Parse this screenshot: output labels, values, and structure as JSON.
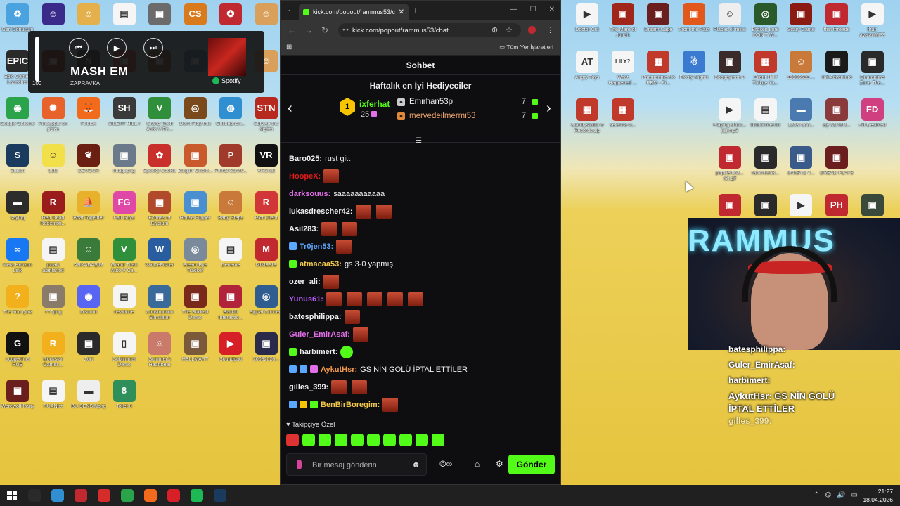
{
  "desktop": {
    "icons": [
      {
        "label": "Geri Dönüşüm",
        "color": "#4aa3df",
        "glyph": "♻"
      },
      {
        "label": "",
        "color": "#3a2a8a",
        "glyph": "☺"
      },
      {
        "label": "",
        "color": "#e3b04b",
        "glyph": "☺"
      },
      {
        "label": "",
        "color": "#f5f5f5",
        "glyph": "▤"
      },
      {
        "label": "",
        "color": "#6b6b6b",
        "glyph": "▣"
      },
      {
        "label": "",
        "color": "#d97b1c",
        "glyph": "CS"
      },
      {
        "label": "",
        "color": "#c0292f",
        "glyph": "✪"
      },
      {
        "label": "",
        "color": "#d9a05b",
        "glyph": "☺"
      },
      {
        "label": "Epic Games Launcher",
        "color": "#2a2a2a",
        "glyph": "EPIC"
      },
      {
        "label": "",
        "color": "#7d1e10",
        "glyph": "▣"
      },
      {
        "label": "",
        "color": "#2a2a2a",
        "glyph": "N"
      },
      {
        "label": "",
        "color": "#b03a2e",
        "glyph": "▣"
      },
      {
        "label": "",
        "color": "#7a4a2a",
        "glyph": "▣"
      },
      {
        "label": "",
        "color": "#3b82c4",
        "glyph": "▣"
      },
      {
        "label": "",
        "color": "#e23c2c",
        "glyph": "▣"
      },
      {
        "label": "",
        "color": "#d9a05b",
        "glyph": "☺"
      },
      {
        "label": "Google Chrome",
        "color": "#2aa34a",
        "glyph": "◉"
      },
      {
        "label": "Pineapple on pizza",
        "color": "#e8632b",
        "glyph": "✺"
      },
      {
        "label": "Firefox",
        "color": "#f26a1b",
        "glyph": "🦊"
      },
      {
        "label": "SILENT HILL f",
        "color": "#3a3a3a",
        "glyph": "SH"
      },
      {
        "label": "Grand Theft Auto V En...",
        "color": "#2f8f3a",
        "glyph": "V"
      },
      {
        "label": "Don't Play this",
        "color": "#7a4a1c",
        "glyph": "◎"
      },
      {
        "label": "Onlinephon...",
        "color": "#2f8fd0",
        "glyph": "◍"
      },
      {
        "label": "Survive the Nights",
        "color": "#b7281f",
        "glyph": "STN"
      },
      {
        "label": "Steam",
        "color": "#1b3b5e",
        "glyph": "S"
      },
      {
        "label": "Luto",
        "color": "#f1e04a",
        "glyph": "☺"
      },
      {
        "label": "DEVOUR",
        "color": "#6b1e12",
        "glyph": "❦"
      },
      {
        "label": "imagepng",
        "color": "#6a7a8a",
        "glyph": "▣"
      },
      {
        "label": "Spooky Cookie",
        "color": "#c9302c",
        "glyph": "✿"
      },
      {
        "label": "Burglin' Gnom...",
        "color": "#c95a2b",
        "glyph": "▣"
      },
      {
        "label": "Primal Surviv...",
        "color": "#a03a2a",
        "glyph": "P"
      },
      {
        "label": "VRChat",
        "color": "#111111",
        "glyph": "VR"
      },
      {
        "label": "saying",
        "color": "#2c2c2c",
        "glyph": "▬"
      },
      {
        "label": "Red Dead Redempti...",
        "color": "#9b1c1c",
        "glyph": "R"
      },
      {
        "label": "Boat Together",
        "color": "#e8b12b",
        "glyph": "⛵"
      },
      {
        "label": "Fall Guys",
        "color": "#e048a8",
        "glyph": "FG"
      },
      {
        "label": "Echoes of Elysium",
        "color": "#b04a2a",
        "glyph": "▣"
      },
      {
        "label": "House Flipper",
        "color": "#4a8fd0",
        "glyph": "▣"
      },
      {
        "label": "Baby Steps",
        "color": "#c97a3a",
        "glyph": "☺"
      },
      {
        "label": "Riot Client",
        "color": "#d13639",
        "glyph": "R"
      },
      {
        "label": "Meta Horizon Link",
        "color": "#1877f2",
        "glyph": "∞"
      },
      {
        "label": "ptcalk alanlarıtxt",
        "color": "#f5f5f5",
        "glyph": "▤"
      },
      {
        "label": "ARKADAŞIM",
        "color": "#3a7a3a",
        "glyph": "☺"
      },
      {
        "label": "Grand Theft Auto V Ca...",
        "color": "#2f8f3a",
        "glyph": "V"
      },
      {
        "label": "WinDeFisher",
        "color": "#2a5d9f",
        "glyph": "W"
      },
      {
        "label": "Steam Eye Tracker",
        "color": "#7a8a9a",
        "glyph": "◎"
      },
      {
        "label": "Deneme",
        "color": "#f5f5f5",
        "glyph": "▤"
      },
      {
        "label": "MIMESIS",
        "color": "#c0292f",
        "glyph": "M"
      },
      {
        "label": "The You Quiz",
        "color": "#f2b01c",
        "glyph": "?"
      },
      {
        "label": "TTTpng",
        "color": "#8a7a6a",
        "glyph": "▣"
      },
      {
        "label": "Discord",
        "color": "#5865f2",
        "glyph": "◉"
      },
      {
        "label": "newdone",
        "color": "#f5f5f5",
        "glyph": "▤"
      },
      {
        "label": "Construction Simulator",
        "color": "#3a6a9a",
        "glyph": "▣"
      },
      {
        "label": "The Stalked Demo",
        "color": "#7a2a1a",
        "glyph": "▣"
      },
      {
        "label": "Backlit Interactio...",
        "color": "#b0233a",
        "glyph": "▣"
      },
      {
        "label": "Signal Connect",
        "color": "#2f5d8f",
        "glyph": "◎"
      },
      {
        "label": "Logitech G HUB",
        "color": "#111111",
        "glyph": "G"
      },
      {
        "label": "Rockstar Games...",
        "color": "#f2b01c",
        "glyph": "R"
      },
      {
        "label": "Zort",
        "color": "#2a2a2a",
        "glyph": "▣"
      },
      {
        "label": "Subliminal Demo",
        "color": "#f5f5f5",
        "glyph": "▯"
      },
      {
        "label": "Summer's Heartbeat",
        "color": "#c97a6a",
        "glyph": "☺"
      },
      {
        "label": "HELLMART",
        "color": "#7a5a3a",
        "glyph": "▣"
      },
      {
        "label": "Soundpad",
        "color": "#d61f26",
        "glyph": "▶"
      },
      {
        "label": "20082026...",
        "color": "#2a2a4a",
        "glyph": "▣"
      },
      {
        "label": "Werewolf Party",
        "color": "#6b1e1e",
        "glyph": "▣"
      },
      {
        "label": "PUANtxt",
        "color": "#f5f5f5",
        "glyph": "▤"
      },
      {
        "label": "BU SENSİNpng",
        "color": "#eeeeee",
        "glyph": "▬"
      },
      {
        "label": "Toilet 8",
        "color": "#2f8f5a",
        "glyph": "8"
      }
    ],
    "right_icons": [
      {
        "label": "Doctor Cut",
        "color": "#f5f5f5",
        "glyph": "▶"
      },
      {
        "label": "The Mare of Jonah",
        "color": "#a0261c",
        "glyph": "▣"
      },
      {
        "label": "Dream Cage",
        "color": "#6b1e1e",
        "glyph": "▣"
      },
      {
        "label": "From the Past",
        "color": "#e2581b",
        "glyph": "▣"
      },
      {
        "label": "Places of mine",
        "color": "#eeeeee",
        "glyph": "☺"
      },
      {
        "label": "Broken Lore DON'T W...",
        "color": "#2a5a2a",
        "glyph": "◎"
      },
      {
        "label": "Scary Game",
        "color": "#8a1a12",
        "glyph": "▣"
      },
      {
        "label": "thin threads",
        "color": "#c0292f",
        "glyph": "▣"
      },
      {
        "label": "fhan avatarıMP3",
        "color": "#f5f5f5",
        "glyph": "▶"
      },
      {
        "label": "Angry Toys",
        "color": "#f5f5f5",
        "glyph": "AT"
      },
      {
        "label": "What Happened ...",
        "color": "#f5f5f5",
        "glyph": "LILY?"
      },
      {
        "label": "Paranormia No REM - Pi...",
        "color": "#c0392b",
        "glyph": "▦"
      },
      {
        "label": "Frosty Nights",
        "color": "#3a7ad0",
        "glyph": "☃"
      },
      {
        "label": "Boogeyman 2",
        "color": "#3a2a2a",
        "glyph": "▣"
      },
      {
        "label": "Silent Hill f Türkçe Ya...",
        "color": "#c0392b",
        "glyph": "▦"
      },
      {
        "label": "$$$$$$$$ ...",
        "color": "#c97a3a",
        "glyph": "☺"
      },
      {
        "label": "Jail Adventure",
        "color": "#1a1a1a",
        "glyph": "▣"
      },
      {
        "label": "Quarantine Zone The...",
        "color": "#2a2a2a",
        "glyph": "▣"
      },
      {
        "label": "Standystudio 0 Records.zip",
        "color": "#c0392b",
        "glyph": "▦"
      },
      {
        "label": "selenna w...",
        "color": "#c0392b",
        "glyph": "▦"
      },
      {
        "label": "Playing show... (1).mp3",
        "color": "#f5f5f5",
        "glyph": "▶"
      },
      {
        "label": "tiktokinmer.txt",
        "color": "#f5f5f5",
        "glyph": "▤"
      },
      {
        "label": "12337160...",
        "color": "#4a7ab0",
        "glyph": "▬"
      },
      {
        "label": "aly 31KUN...",
        "color": "#8a3a3a",
        "glyph": "▣"
      },
      {
        "label": "Fill-Destined",
        "color": "#d04080",
        "glyph": "FD"
      },
      {
        "label": "popillertiha... (3).gif",
        "color": "#c0292f",
        "glyph": "▣"
      },
      {
        "label": "rammus53...",
        "color": "#2a2a2a",
        "glyph": "▣"
      },
      {
        "label": "5f4c94f1 4...",
        "color": "#3a5a8a",
        "glyph": "▣"
      },
      {
        "label": "DREAD FLATS",
        "color": "#6b1e1e",
        "glyph": "▣"
      },
      {
        "label": "",
        "color": "#c0292f",
        "glyph": "▣"
      },
      {
        "label": "",
        "color": "#2a2a2a",
        "glyph": "▣"
      },
      {
        "label": "",
        "color": "#f5f5f5",
        "glyph": "▶"
      },
      {
        "label": "",
        "color": "#c0292f",
        "glyph": "PH"
      },
      {
        "label": "",
        "color": "#3a4a3a",
        "glyph": "▣"
      }
    ]
  },
  "spotify": {
    "volume": "100",
    "volume_level": 1.0,
    "track": "MASH EM",
    "artist": "ZAPRAVKA",
    "brand": "Spotify",
    "prev": "⏮",
    "play": "▶",
    "next": "⏭"
  },
  "browser": {
    "tab_title": "kick.com/popout/rammus53/ch",
    "new_tab": "+",
    "url": "kick.com/popout/rammus53/chat",
    "bookmarks_all": "Tüm Yer İşaretleri",
    "back": "←",
    "forward": "→",
    "reload": "↻"
  },
  "chat": {
    "header": "Sohbet",
    "gifters_title": "Haftalık en İyi Hediyeciler",
    "top_gifter": {
      "rank": "1",
      "name": "ixferhat",
      "count": "25"
    },
    "gifters": [
      {
        "name": "Emirhan53p",
        "count": "7",
        "badge_color": "#cccccc",
        "badge": "✦"
      },
      {
        "name": "mervedeilmermi53",
        "count": "7",
        "badge_color": "#e0893a",
        "badge": "✦"
      }
    ],
    "messages": [
      {
        "user": "Baro025:",
        "color": "#efeff1",
        "text": "rust gitt",
        "emotes": 0,
        "badges": []
      },
      {
        "user": "HoopeX:",
        "color": "#e01b1b",
        "text": "",
        "emotes": 1,
        "badges": []
      },
      {
        "user": "darksouus:",
        "color": "#e06fe8",
        "text": "saaaaaaaaaaa",
        "emotes": 0,
        "badges": []
      },
      {
        "user": "lukasdrescher42:",
        "color": "#efeff1",
        "text": "",
        "emotes": 2,
        "badges": []
      },
      {
        "user": "Asil283:",
        "color": "#efeff1",
        "text": "",
        "emotes": 2,
        "badges": []
      },
      {
        "user": "Tr0jen53:",
        "color": "#5aa8ff",
        "text": "",
        "emotes": 1,
        "badges": [
          "#5aa8ff"
        ]
      },
      {
        "user": "atmacaa53:",
        "color": "#f2c94c",
        "text": "gs 3-0 yapmış",
        "emotes": 0,
        "badges": [
          "#53fc18"
        ]
      },
      {
        "user": "ozer_ali:",
        "color": "#efeff1",
        "text": "",
        "emotes": 1,
        "badges": []
      },
      {
        "user": "Yunus61:",
        "color": "#b45cf2",
        "text": "",
        "emotes": 5,
        "badges": []
      },
      {
        "user": "batesphilippa:",
        "color": "#efeff1",
        "text": "",
        "emotes": 1,
        "badges": []
      },
      {
        "user": "Guler_EmirAsaf:",
        "color": "#e06fe8",
        "text": "",
        "emotes": 1,
        "badges": []
      },
      {
        "user": "harbimert:",
        "color": "#efeff1",
        "text": "",
        "emotes": 0,
        "green": true,
        "badges": [
          "#53fc18"
        ]
      },
      {
        "user": "AykutHsr:",
        "color": "#f2994a",
        "text": "GS NİN GOLÜ İPTAL ETTİLER",
        "emotes": 0,
        "badges": [
          "#5aa8ff",
          "#5aa8ff",
          "#e06fe8"
        ]
      },
      {
        "user": "gilles_399:",
        "color": "#efeff1",
        "text": "",
        "emotes": 2,
        "badges": []
      },
      {
        "user": "BenBirBoregim:",
        "color": "#f2c94c",
        "text": "",
        "emotes": 1,
        "badges": [
          "#5aa8ff",
          "#f6c500",
          "#53fc18"
        ]
      }
    ],
    "emote_section": "Takipçiye Özel",
    "emote_count": 10,
    "input_placeholder": "Bir mesaj gönderin",
    "send_label": "Gönder"
  },
  "overlay": {
    "lines": [
      {
        "text": "batesphilippa:",
        "faded": false
      },
      {
        "text": "Guler_EmirAsaf:",
        "faded": false
      },
      {
        "text": "harbimert:",
        "faded": false
      },
      {
        "text": "AykutHsr: GS NİN GOLÜ",
        "faded": false
      },
      {
        "text": "İPTAL ETTİLER",
        "faded": false
      },
      {
        "text": "gilles_399:",
        "faded": true
      }
    ],
    "webcam_logo": "RAMMUS"
  },
  "taskbar": {
    "time": "21:27",
    "date": "18.04.2026",
    "apps": [
      {
        "name": "search",
        "color": "#2a2a2a"
      },
      {
        "name": "app-1",
        "color": "#2f8fd0"
      },
      {
        "name": "app-2",
        "color": "#c0292f"
      },
      {
        "name": "app-3",
        "color": "#d62b2b"
      },
      {
        "name": "app-4",
        "color": "#2aa34a"
      },
      {
        "name": "app-5",
        "color": "#f26a1b"
      },
      {
        "name": "app-6",
        "color": "#d61f26"
      },
      {
        "name": "app-7",
        "color": "#1db954"
      },
      {
        "name": "app-8",
        "color": "#1b3b5e"
      }
    ]
  }
}
